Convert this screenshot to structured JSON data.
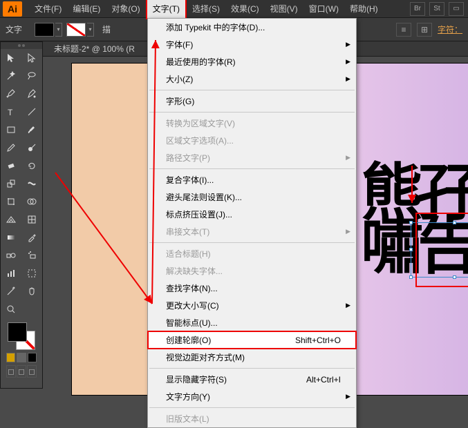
{
  "menubar": {
    "items": [
      "文件(F)",
      "编辑(E)",
      "对象(O)",
      "文字(T)",
      "选择(S)",
      "效果(C)",
      "视图(V)",
      "窗口(W)",
      "帮助(H)"
    ],
    "active_index": 3
  },
  "controlbar": {
    "panel_label": "文字",
    "stroke_label": "描",
    "char_link": "字符："
  },
  "doc_tab": "未标题-2* @ 100% (R",
  "menu": {
    "groups": [
      [
        {
          "label": "添加 Typekit 中的字体(D)..."
        },
        {
          "label": "字体(F)",
          "submenu": true
        },
        {
          "label": "最近使用的字体(R)",
          "submenu": true
        },
        {
          "label": "大小(Z)",
          "submenu": true
        }
      ],
      [
        {
          "label": "字形(G)"
        }
      ],
      [
        {
          "label": "转换为区域文字(V)",
          "disabled": true
        },
        {
          "label": "区域文字选项(A)...",
          "disabled": true
        },
        {
          "label": "路径文字(P)",
          "submenu": true,
          "disabled": true
        }
      ],
      [
        {
          "label": "复合字体(I)..."
        },
        {
          "label": "避头尾法则设置(K)..."
        },
        {
          "label": "标点挤压设置(J)..."
        },
        {
          "label": "串接文本(T)",
          "submenu": true,
          "disabled": true
        }
      ],
      [
        {
          "label": "适合标题(H)",
          "disabled": true
        },
        {
          "label": "解决缺失字体...",
          "disabled": true
        },
        {
          "label": "查找字体(N)..."
        },
        {
          "label": "更改大小写(C)",
          "submenu": true
        },
        {
          "label": "智能标点(U)..."
        },
        {
          "label": "创建轮廓(O)",
          "shortcut": "Shift+Ctrl+O",
          "highlighted": true
        },
        {
          "label": "视觉边距对齐方式(M)"
        }
      ],
      [
        {
          "label": "显示隐藏字符(S)",
          "shortcut": "Alt+Ctrl+I"
        },
        {
          "label": "文字方向(Y)",
          "submenu": true
        }
      ],
      [
        {
          "label": "旧版文本(L)",
          "disabled": true
        }
      ]
    ]
  },
  "canvas": {
    "glyph_text": "熊孖\n嘯告"
  },
  "tools": [
    "selection",
    "direct-selection",
    "magic-wand",
    "lasso",
    "pen",
    "curvature",
    "type",
    "line",
    "rectangle",
    "brush",
    "pencil",
    "blob-brush",
    "eraser",
    "rotate",
    "scale",
    "width",
    "free-transform",
    "shape-builder",
    "perspective",
    "mesh",
    "gradient",
    "eyedropper",
    "blend",
    "symbol-spray",
    "graph",
    "artboard",
    "slice",
    "hand",
    "zoom",
    "fill-toggle"
  ]
}
